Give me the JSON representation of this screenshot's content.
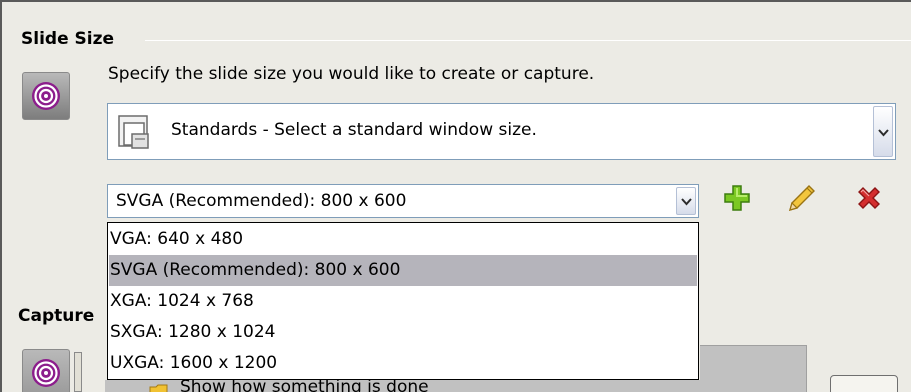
{
  "slide_size": {
    "section_title": "Slide Size",
    "instruction": "Specify the slide size you would like to create or capture.",
    "mode_combo": {
      "selected": "Standards - Select a standard window size."
    },
    "size_combo": {
      "selected": "SVGA (Recommended): 800 x 600",
      "options": [
        "VGA: 640 x 480",
        "SVGA (Recommended): 800 x 600",
        "XGA: 1024 x 768",
        "SXGA: 1280 x 1024",
        "UXGA: 1600 x 1200"
      ],
      "highlighted_index": 1
    },
    "tools": {
      "add_icon": "plus-icon",
      "edit_icon": "pencil-icon",
      "delete_icon": "x-icon"
    }
  },
  "capture": {
    "section_title_partial": "Capture",
    "option_text_partial": "Show how something is done"
  },
  "colors": {
    "background": "#ecebe5",
    "highlight": "#b5b4bb",
    "add_green": "#7bc823",
    "delete_red": "#d42e2e",
    "pencil_yellow": "#f3c63d"
  }
}
